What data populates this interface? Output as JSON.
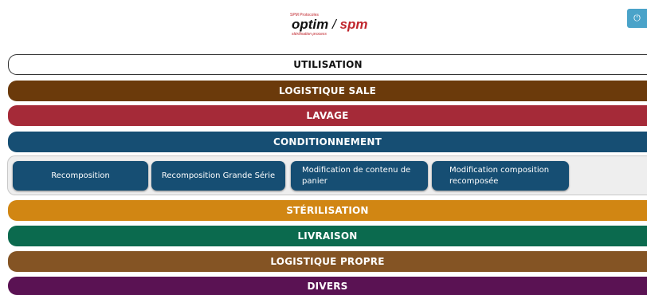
{
  "header": {
    "logo": {
      "top_text": "SPM Protocoles",
      "word_optim": "optim",
      "slash": "/",
      "word_spm": "spm",
      "sub_text": "stérilisation process"
    },
    "power_icon": "power-icon",
    "power_glyph": "⏻",
    "power_color": "#4aa3c9"
  },
  "menu": [
    {
      "label": "UTILISATION",
      "color": "#ffffff"
    },
    {
      "label": "LOGISTIQUE SALE",
      "color": "#6b3a0b"
    },
    {
      "label": "LAVAGE",
      "color": "#a52a38"
    },
    {
      "label": "CONDITIONNEMENT",
      "color": "#164e73"
    },
    {
      "label": "STÉRILISATION",
      "color": "#d18613"
    },
    {
      "label": "LIVRAISON",
      "color": "#0b6a4e"
    },
    {
      "label": "LOGISTIQUE PROPRE",
      "color": "#845424"
    },
    {
      "label": "DIVERS",
      "color": "#5a1253"
    }
  ],
  "submenu": {
    "parent": "CONDITIONNEMENT",
    "items": [
      {
        "label": "Recomposition"
      },
      {
        "label": "Recomposition Grande Série"
      },
      {
        "label": "Modification de contenu de panier"
      },
      {
        "label": "Modification composition recomposée"
      }
    ]
  }
}
